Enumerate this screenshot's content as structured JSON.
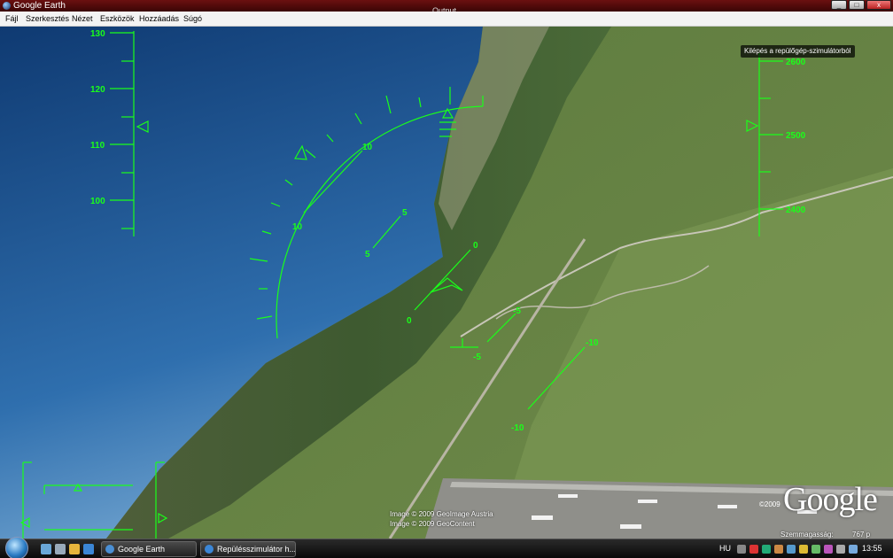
{
  "window": {
    "title": "Google Earth",
    "output_label": "Output",
    "controls": {
      "minimize": "_",
      "maximize": "□",
      "close": "x"
    }
  },
  "menu": [
    "Fájl",
    "Szerkesztés",
    "Nézet",
    "Eszközök",
    "Hozzáadás",
    "Súgó"
  ],
  "hud": {
    "speed_labels": [
      "130",
      "120",
      "110",
      "100"
    ],
    "altitude_labels": [
      "2600",
      "2500",
      "2400"
    ],
    "pitch_labels": [
      "10",
      "10",
      "5",
      "5",
      "0",
      "0",
      "-5",
      "-5",
      "-10",
      "-10"
    ],
    "color": "#1aff1a"
  },
  "overlay": {
    "exit_sim": "Kilépés a repülőgép-szimulátorból",
    "copyright_line1": "Image © 2009 GeoImage Austria",
    "copyright_line2": "Image © 2009 GeoContent",
    "logo": "Google",
    "logo_year": "©2009",
    "eye_alt_label": "Szemmagasság:",
    "eye_alt_value": "767 p"
  },
  "taskbar": {
    "tasks": [
      "Google Earth",
      "Repülésszimulátor h..."
    ],
    "language": "HU",
    "clock": "13:55"
  }
}
